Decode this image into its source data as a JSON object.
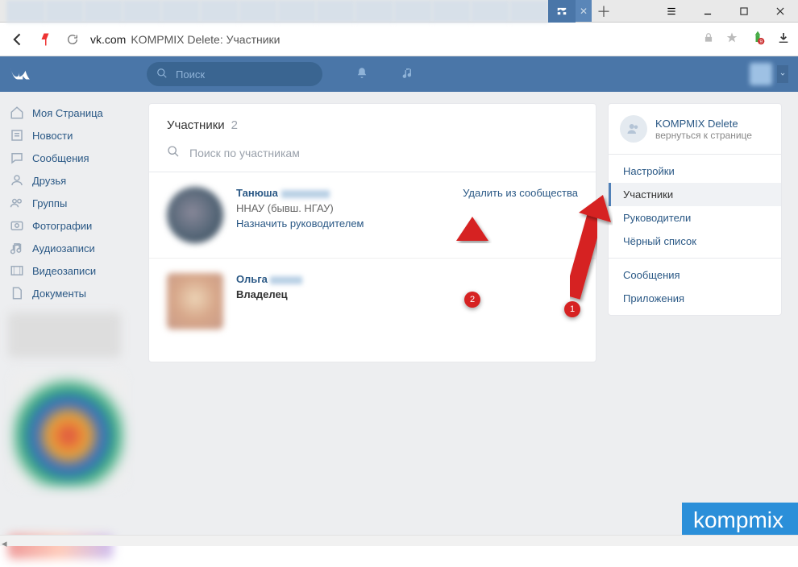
{
  "browser": {
    "url_host": "vk.com",
    "url_title": "KOMPMIX Delete: Участники"
  },
  "vk": {
    "search_placeholder": "Поиск"
  },
  "nav": {
    "items": [
      {
        "icon": "home",
        "label": "Моя Страница"
      },
      {
        "icon": "news",
        "label": "Новости"
      },
      {
        "icon": "msg",
        "label": "Сообщения"
      },
      {
        "icon": "friends",
        "label": "Друзья"
      },
      {
        "icon": "groups",
        "label": "Группы"
      },
      {
        "icon": "photos",
        "label": "Фотографии"
      },
      {
        "icon": "audio",
        "label": "Аудиозаписи"
      },
      {
        "icon": "video",
        "label": "Видеозаписи"
      },
      {
        "icon": "docs",
        "label": "Документы"
      }
    ]
  },
  "main": {
    "title": "Участники",
    "count": "2",
    "search_placeholder": "Поиск по участникам",
    "members": [
      {
        "name": "Танюша",
        "sub": "ННАУ (бывш. НГАУ)",
        "assign": "Назначить руководителем",
        "remove": "Удалить из сообщества"
      },
      {
        "name": "Ольга",
        "owner": "Владелец"
      }
    ]
  },
  "right": {
    "group_title": "KOMPMIX Delete",
    "back": "вернуться к странице",
    "menu1": [
      {
        "label": "Настройки",
        "active": false
      },
      {
        "label": "Участники",
        "active": true
      },
      {
        "label": "Руководители",
        "active": false
      },
      {
        "label": "Чёрный список",
        "active": false
      }
    ],
    "menu2": [
      {
        "label": "Сообщения"
      },
      {
        "label": "Приложения"
      }
    ]
  },
  "annotations": {
    "arrow1": "1",
    "arrow2": "2"
  },
  "watermark": "kompmix"
}
